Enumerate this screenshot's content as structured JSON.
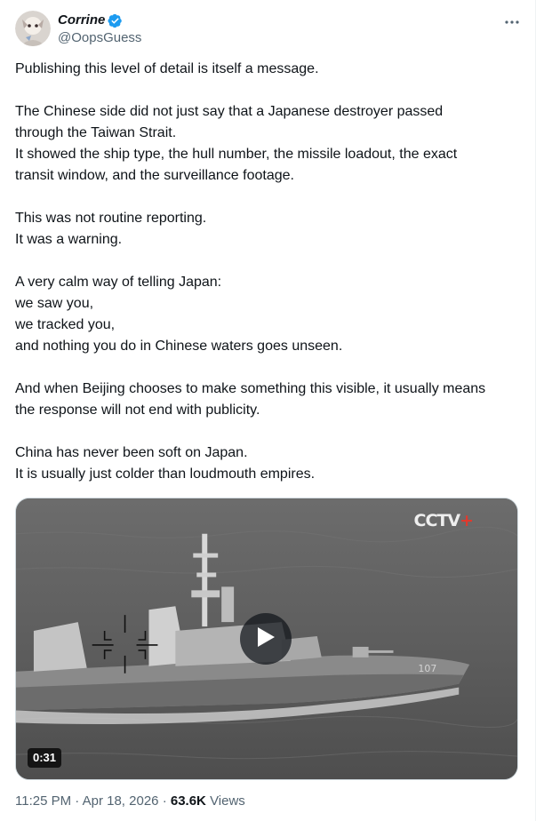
{
  "author": {
    "display_name": "Corrine",
    "handle": "@OopsGuess",
    "verified": true
  },
  "post": {
    "paragraphs": [
      [
        "Publishing this level of detail is itself a message."
      ],
      [
        "The Chinese side did not just say that a Japanese destroyer passed",
        "through the Taiwan Strait.",
        "It showed the ship type, the hull number, the missile loadout, the exact",
        "transit window, and the surveillance footage."
      ],
      [
        "This was not routine reporting.",
        "It was a warning."
      ],
      [
        "A very calm way of telling Japan:",
        "we saw you,",
        "we tracked you,",
        "and nothing you do in Chinese waters goes unseen."
      ],
      [
        "And when Beijing chooses to make something this visible, it usually means",
        "the response will not end with publicity."
      ],
      [
        "China has never been soft on Japan.",
        "It is usually just colder than loudmouth empires."
      ]
    ]
  },
  "media": {
    "duration": "0:31",
    "watermark": "CCTV",
    "watermark_plus": "+",
    "hull_number": "107"
  },
  "meta": {
    "time": "11:25 PM",
    "separator": "·",
    "date": "Apr 18, 2026",
    "views_count": "63.6K",
    "views_label": "Views"
  },
  "colors": {
    "verified_blue": "#1d9bf0",
    "secondary_text": "#536471",
    "primary_text": "#0f1419"
  },
  "icons": {
    "verified": "verified-badge-icon",
    "more": "more-dots-icon",
    "play": "play-icon"
  }
}
